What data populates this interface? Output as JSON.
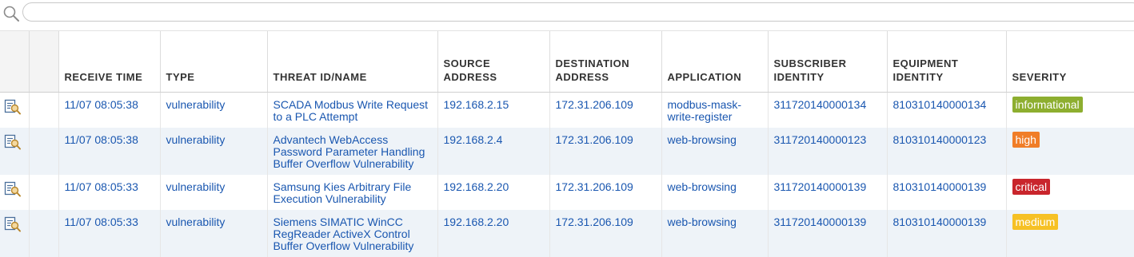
{
  "search": {
    "value": "",
    "placeholder": ""
  },
  "columns": {
    "receive_time": "RECEIVE TIME",
    "type": "TYPE",
    "threat": "THREAT ID/NAME",
    "source": "SOURCE ADDRESS",
    "destination": "DESTINATION ADDRESS",
    "application": "APPLICATION",
    "subscriber": "SUBSCRIBER IDENTITY",
    "equipment": "EQUIPMENT IDENTITY",
    "severity": "SEVERITY"
  },
  "severity_colors": {
    "informational": "#8dae2f",
    "high": "#f07d27",
    "critical": "#c9252c",
    "medium": "#f6c125"
  },
  "rows": [
    {
      "receive_time": "11/07 08:05:38",
      "type": "vulnerability",
      "threat": "SCADA Modbus Write Request to a PLC Attempt",
      "source": "192.168.2.15",
      "destination": "172.31.206.109",
      "application": "modbus-mask-write-register",
      "subscriber": "311720140000134",
      "equipment": "810310140000134",
      "severity": "informational"
    },
    {
      "receive_time": "11/07 08:05:38",
      "type": "vulnerability",
      "threat": "Advantech WebAccess Password Parameter Handling Buffer Overflow Vulnerability",
      "source": "192.168.2.4",
      "destination": "172.31.206.109",
      "application": "web-browsing",
      "subscriber": "311720140000123",
      "equipment": "810310140000123",
      "severity": "high"
    },
    {
      "receive_time": "11/07 08:05:33",
      "type": "vulnerability",
      "threat": "Samsung Kies Arbitrary File Execution Vulnerability",
      "source": "192.168.2.20",
      "destination": "172.31.206.109",
      "application": "web-browsing",
      "subscriber": "311720140000139",
      "equipment": "810310140000139",
      "severity": "critical"
    },
    {
      "receive_time": "11/07 08:05:33",
      "type": "vulnerability",
      "threat": "Siemens SIMATIC WinCC RegReader ActiveX Control Buffer Overflow Vulnerability",
      "source": "192.168.2.20",
      "destination": "172.31.206.109",
      "application": "web-browsing",
      "subscriber": "311720140000139",
      "equipment": "810310140000139",
      "severity": "medium"
    }
  ]
}
